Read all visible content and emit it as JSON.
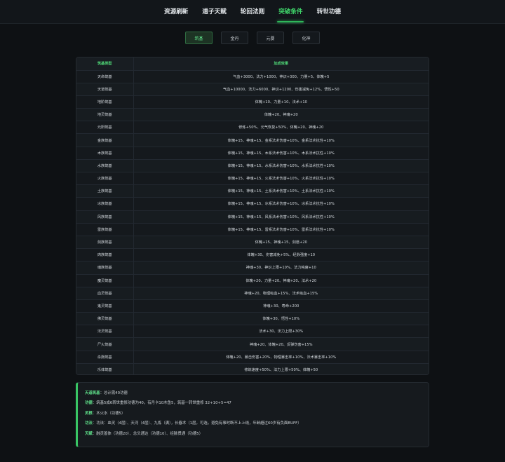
{
  "nav": {
    "items": [
      {
        "label": "资源刷新",
        "active": false
      },
      {
        "label": "道子天赋",
        "active": false
      },
      {
        "label": "轮回法则",
        "active": false
      },
      {
        "label": "突破条件",
        "active": true
      },
      {
        "label": "转世功德",
        "active": false
      }
    ]
  },
  "subtabs": [
    {
      "label": "筑基",
      "active": true
    },
    {
      "label": "金丹",
      "active": false
    },
    {
      "label": "元婴",
      "active": false
    },
    {
      "label": "化神",
      "active": false
    }
  ],
  "table": {
    "headers": {
      "type": "筑基类型",
      "effect": "加成效果"
    },
    "rows": [
      {
        "type": "天命筑基",
        "effect": "气血+3000、法力+1000、神识+300、力量+5、体魄+5"
      },
      {
        "type": "天道筑基",
        "effect": "气血+10000、法力+6000、神识+1200、伤害减免+12%、悟性+50"
      },
      {
        "type": "地阶筑基",
        "effect": "体魄+10、力量+10、法术+10"
      },
      {
        "type": "地灵筑基",
        "effect": "体魄+20、神魂+20"
      },
      {
        "type": "元阳筑基",
        "effect": "修炼+50%、元气恢复+50%、体魄+20、神魂+20"
      },
      {
        "type": "金族筑基",
        "effect": "体魄+15、神魂+15、金系法术伤害+10%、金系法术抗性+10%"
      },
      {
        "type": "木族筑基",
        "effect": "体魄+15、神魂+15、木系法术伤害+10%、木系法术抗性+10%"
      },
      {
        "type": "水族筑基",
        "effect": "体魄+15、神魂+15、水系法术伤害+10%、水系法术抗性+10%"
      },
      {
        "type": "火族筑基",
        "effect": "体魄+15、神魂+15、火系法术伤害+10%、火系法术抗性+10%"
      },
      {
        "type": "土族筑基",
        "effect": "体魄+15、神魂+15、土系法术伤害+10%、土系法术抗性+10%"
      },
      {
        "type": "冰族筑基",
        "effect": "体魄+15、神魂+15、冰系法术伤害+10%、冰系法术抗性+10%"
      },
      {
        "type": "风族筑基",
        "effect": "体魄+15、神魂+15、风系法术伤害+10%、风系法术抗性+10%"
      },
      {
        "type": "雷族筑基",
        "effect": "体魄+15、神魂+15、雷系法术伤害+10%、雷系法术抗性+10%"
      },
      {
        "type": "剑族筑基",
        "effect": "体魄+15、神魂+15、剑道+20"
      },
      {
        "type": "肉族筑基",
        "effect": "体魄+30、伤害减免+5%、经脉强度+10"
      },
      {
        "type": "魂族筑基",
        "effect": "神魂+30、神识上限+10%、法力纯度+10"
      },
      {
        "type": "魔灵筑基",
        "effect": "体魄+20、力量+20、神魂+20、法术+20"
      },
      {
        "type": "血灵筑基",
        "effect": "神魂+20、物理吸血+15%、法术吸血+15%"
      },
      {
        "type": "鬼灵筑基",
        "effect": "神魂+30、寿命+200"
      },
      {
        "type": "佛灵筑基",
        "effect": "体魄+30、悟性+10%"
      },
      {
        "type": "法灵筑基",
        "effect": "法术+30、法力上限+30%"
      },
      {
        "type": "尸火筑基",
        "effect": "神魂+20、体魄+20、反弹伤害+15%"
      },
      {
        "type": "杀戮筑基",
        "effect": "体魄+20、暴击伤害+20%、物理暴击率+10%、法术暴击率+10%"
      },
      {
        "type": "乐体筑基",
        "effect": "修炼速度+50%、法力上限+50%、体魄+50"
      }
    ]
  },
  "info": [
    {
      "label": "天道筑基",
      "text": "：总计需40功德"
    },
    {
      "label": "功德",
      "text": "：筑基5成6转世重修功德为40，有月卡10木鱼5，筑基一转世重修 32+10+5=47"
    },
    {
      "label": "灵根",
      "text": "：木火水（功德5）"
    },
    {
      "label": "功法",
      "text": "：功法：血灵（4层）、天河（4层）、九炼（满），长春术（1层，可选，避免有事时断不上上线，年龄超过60岁有负面BUFF）"
    },
    {
      "label": "天赋",
      "text": "：融灵善体（功德20）、念头通达（功德10）、经脉贯通（功德5）"
    }
  ],
  "colors": {
    "accent": "#3fd56a",
    "background": "#0e1114",
    "panel": "#15191d"
  }
}
